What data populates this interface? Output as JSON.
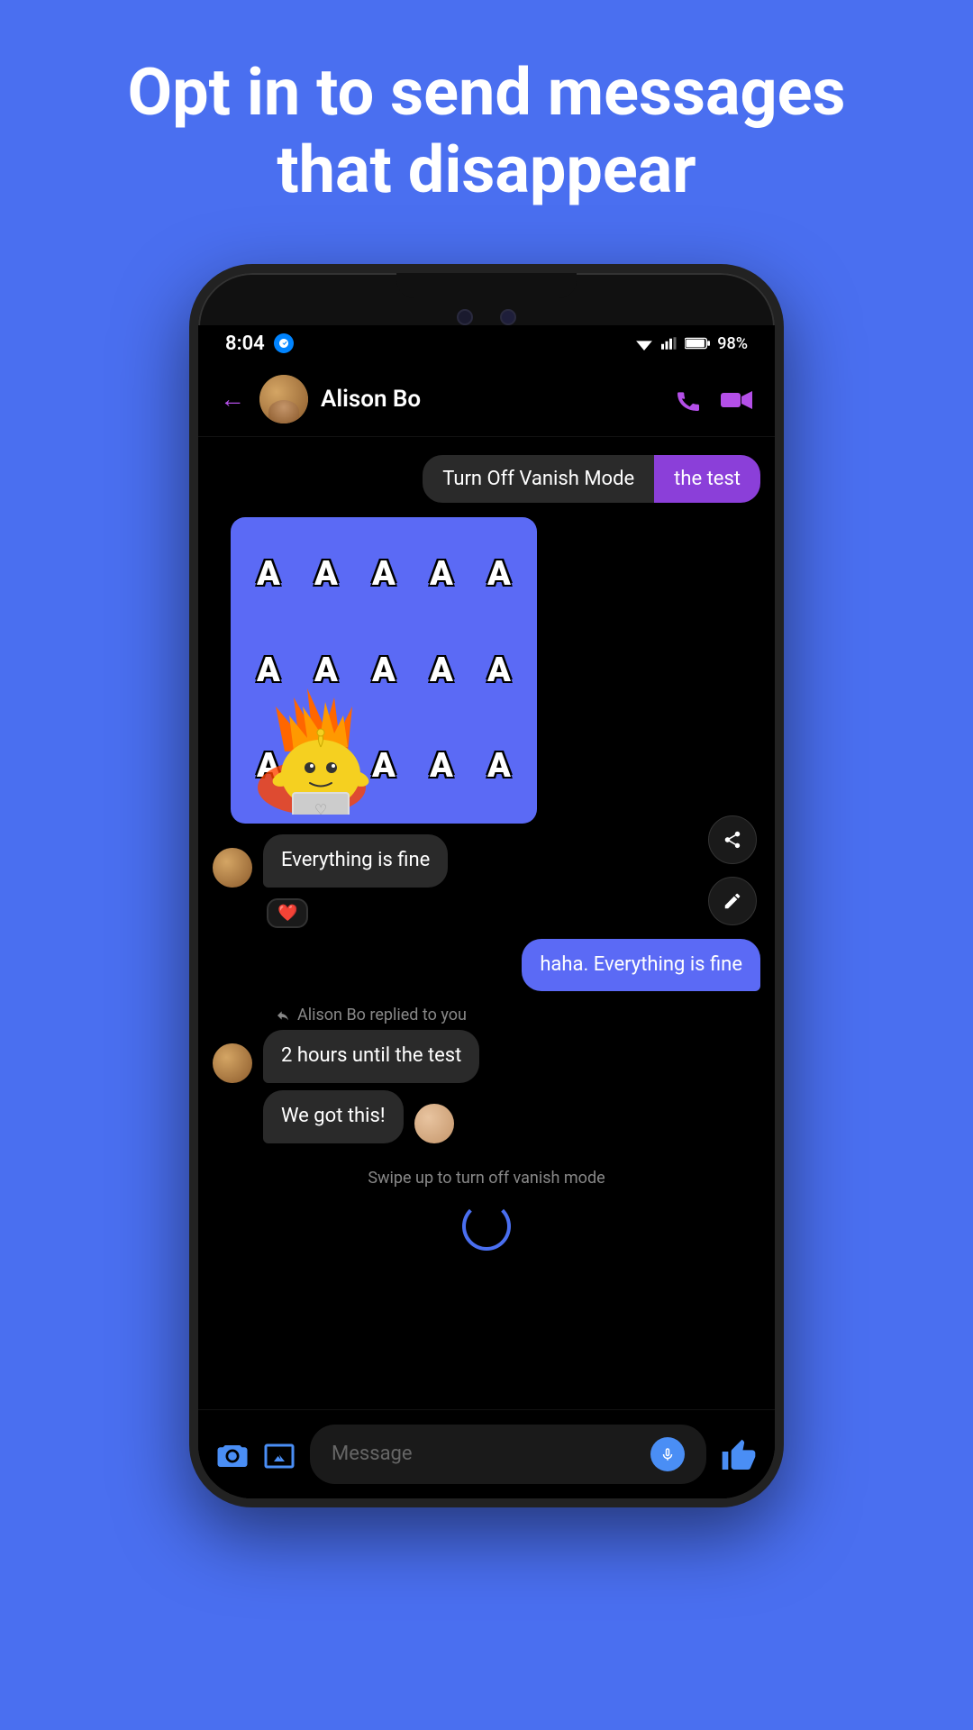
{
  "hero": {
    "title": "Opt in to send messages that disappear"
  },
  "status_bar": {
    "time": "8:04",
    "battery": "98%"
  },
  "header": {
    "contact_name": "Alison Bo",
    "back_label": "←",
    "call_icon": "phone",
    "video_icon": "video"
  },
  "messages": [
    {
      "id": "msg1",
      "type": "sent_split",
      "part1": "Turn Off Vanish Mode",
      "part2": "the test",
      "sender": "self"
    },
    {
      "id": "msg2",
      "type": "sticker",
      "alt": "AAAAAA stressed cat sticker"
    },
    {
      "id": "msg3",
      "type": "received",
      "text": "Everything is fine",
      "reaction": "❤️"
    },
    {
      "id": "msg4",
      "type": "sent",
      "text": "haha. Everything is fine",
      "color": "purple"
    },
    {
      "id": "msg5",
      "type": "reply_group",
      "reply_indicator": "Alison Bo replied to you",
      "messages": [
        {
          "text": "2 hours until the test"
        },
        {
          "text": "We got this!"
        }
      ]
    }
  ],
  "swipe_text": "Swipe up to turn off vanish mode",
  "input": {
    "placeholder": "Message"
  },
  "sticker_letters": [
    "A",
    "A",
    "A",
    "A",
    "A",
    "A",
    "A",
    "A",
    "A",
    "A",
    "A",
    "A",
    "A",
    "A",
    "A"
  ]
}
